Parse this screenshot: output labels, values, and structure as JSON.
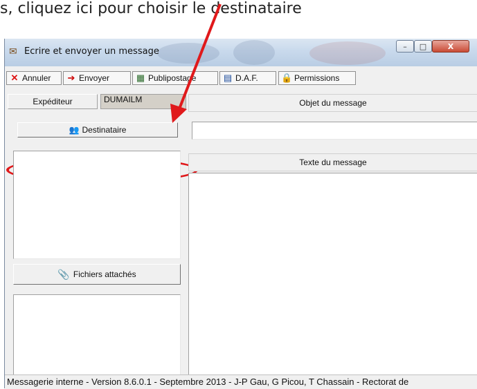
{
  "caption": "s, cliquez ici pour choisir le destinataire",
  "window": {
    "title": "Ecrire et envoyer un message",
    "controls": {
      "minimize": "–",
      "maximize": "□",
      "close": "X"
    }
  },
  "toolbar": {
    "annuler": {
      "label": "Annuler",
      "icon": "x-icon"
    },
    "envoyer": {
      "label": "Envoyer",
      "icon": "send-icon"
    },
    "publipostage": {
      "label": "Publipostage",
      "icon": "mailmerge-icon"
    },
    "daf": {
      "label": "D.A.F.",
      "icon": "building-icon"
    },
    "permissions": {
      "label": "Permissions",
      "icon": "lock-icon"
    }
  },
  "sender": {
    "label": "Expéditeur",
    "value": "DUMAILM"
  },
  "subject": {
    "header": "Objet du message",
    "value": ""
  },
  "recipient": {
    "button_label": "Destinataire"
  },
  "attachments": {
    "button_label": "Fichiers attachés"
  },
  "body": {
    "header": "Texte du message",
    "value": ""
  },
  "status": "Messagerie interne - Version 8.6.0.1 - Septembre 2013 - J-P Gau, G Picou, T Chassain - Rectorat de",
  "colors": {
    "annotation_red": "#e0191b"
  }
}
